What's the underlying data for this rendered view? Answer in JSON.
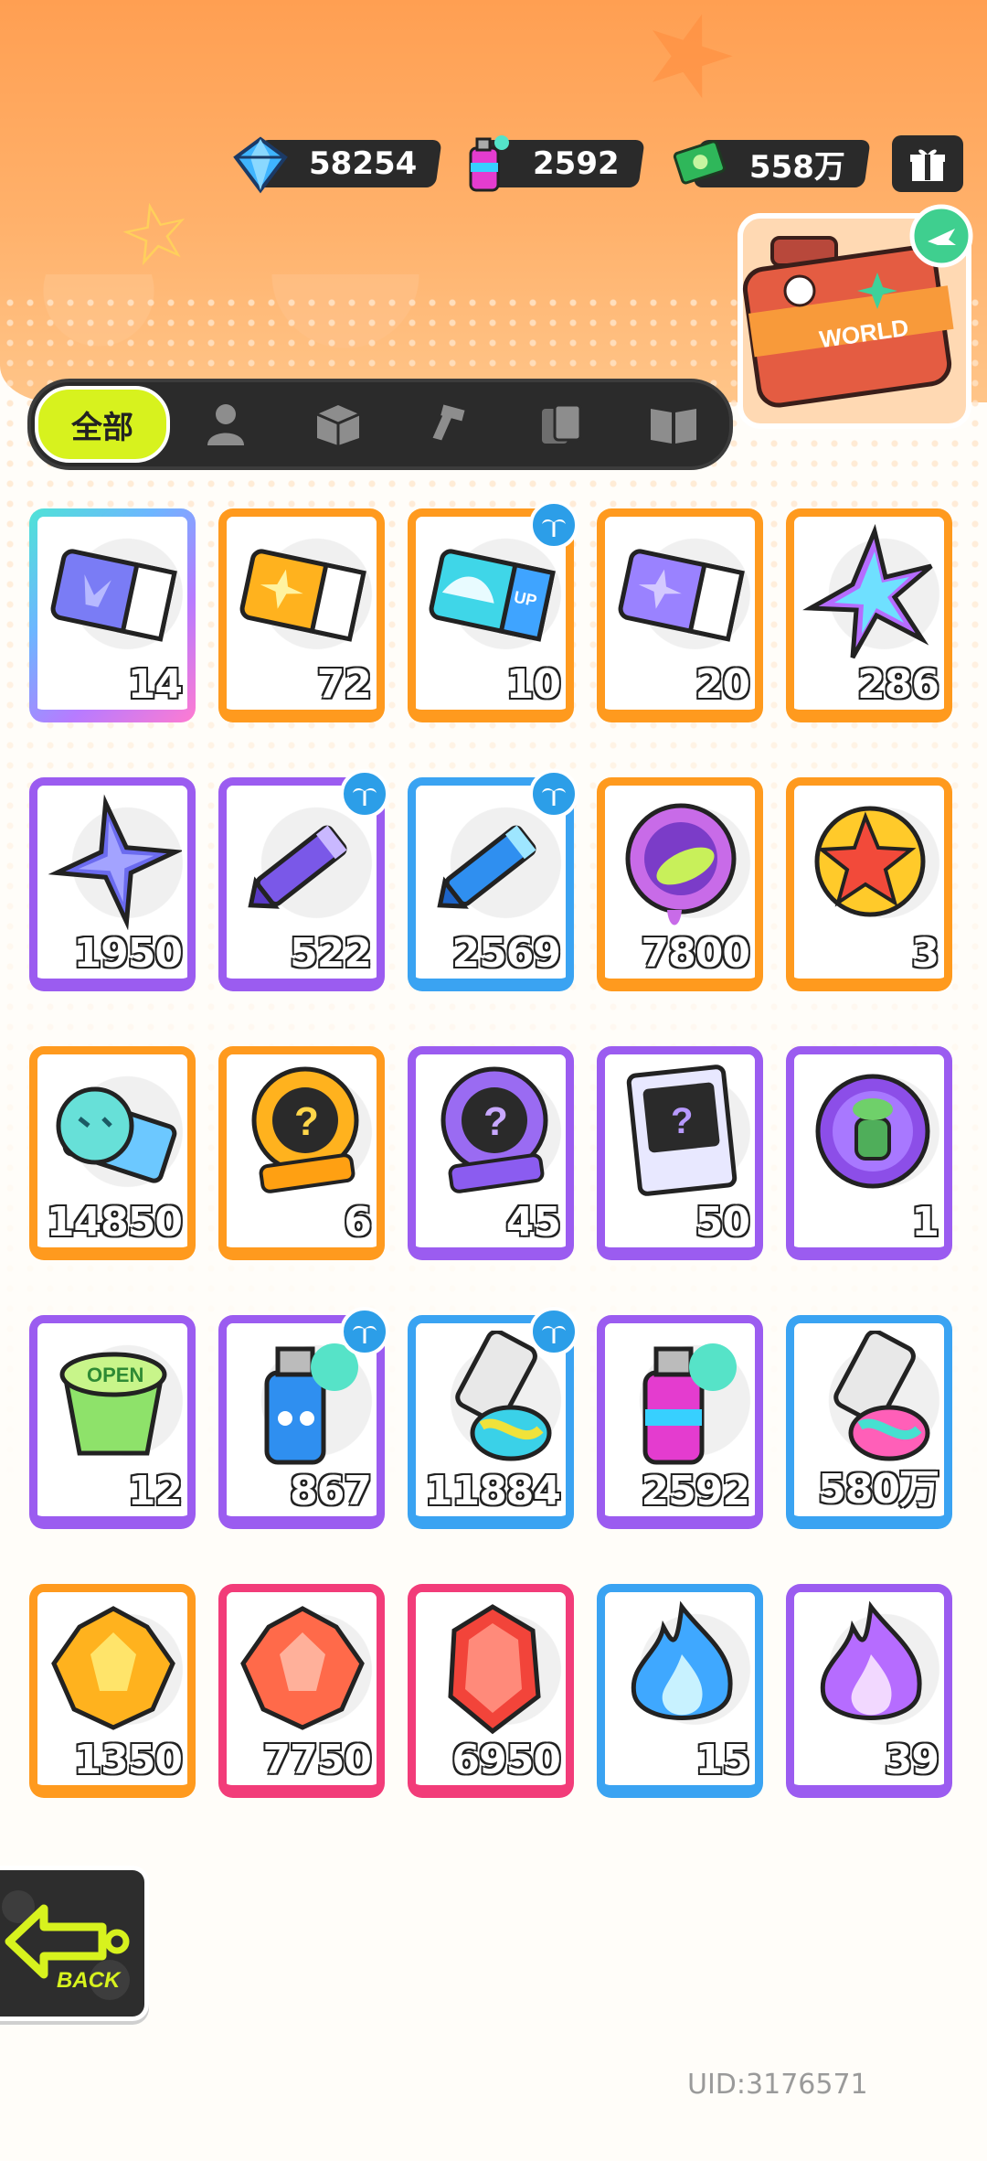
{
  "currency": [
    {
      "icon": "diamond-icon",
      "value": "58254"
    },
    {
      "icon": "spray-can-icon",
      "value": "2592"
    },
    {
      "icon": "cash-icon",
      "value": "558万"
    }
  ],
  "world_badge": {
    "label": "WORLD"
  },
  "tabs": {
    "all_label": "全部",
    "icons": [
      "person-icon",
      "box-icon",
      "gun-icon",
      "cards-icon",
      "book-icon"
    ]
  },
  "items": [
    {
      "art": "ticket-purple",
      "count": "14",
      "frame": "rainbow",
      "badge": false
    },
    {
      "art": "ticket-gold",
      "count": "72",
      "frame": "orange",
      "badge": false
    },
    {
      "art": "ticket-wave",
      "count": "10",
      "frame": "orange",
      "badge": true
    },
    {
      "art": "ticket-violet",
      "count": "20",
      "frame": "orange",
      "badge": false
    },
    {
      "art": "star-rainbow",
      "count": "286",
      "frame": "orange",
      "badge": false
    },
    {
      "art": "star-blue",
      "count": "1950",
      "frame": "purple",
      "badge": false
    },
    {
      "art": "crayon-purple",
      "count": "522",
      "frame": "purple",
      "badge": true
    },
    {
      "art": "crayon-blue",
      "count": "2569",
      "frame": "blue",
      "badge": true
    },
    {
      "art": "cool-badge",
      "count": "7800",
      "frame": "orange",
      "badge": false
    },
    {
      "art": "star-badge",
      "count": "3",
      "frame": "orange",
      "badge": false
    },
    {
      "art": "season-ticket",
      "count": "14850",
      "frame": "orange",
      "badge": false
    },
    {
      "art": "deity-gold",
      "count": "6",
      "frame": "orange",
      "badge": false
    },
    {
      "art": "deity-purple",
      "count": "45",
      "frame": "purple",
      "badge": false
    },
    {
      "art": "travel-card",
      "count": "50",
      "frame": "purple",
      "badge": false
    },
    {
      "art": "pet-ball",
      "count": "1",
      "frame": "purple",
      "badge": false
    },
    {
      "art": "open-cup",
      "count": "12",
      "frame": "purple",
      "badge": false
    },
    {
      "art": "spray-blue",
      "count": "867",
      "frame": "purple",
      "badge": true
    },
    {
      "art": "tube-blue",
      "count": "11884",
      "frame": "blue",
      "badge": true
    },
    {
      "art": "spray-pink",
      "count": "2592",
      "frame": "purple",
      "badge": false
    },
    {
      "art": "tube-pink",
      "count": "580万",
      "frame": "blue",
      "badge": false
    },
    {
      "art": "gem-gold",
      "count": "1350",
      "frame": "orange",
      "badge": false
    },
    {
      "art": "gem-red",
      "count": "7750",
      "frame": "pink",
      "badge": false
    },
    {
      "art": "crystal-red",
      "count": "6950",
      "frame": "pink",
      "badge": false
    },
    {
      "art": "flame-blue",
      "count": "15",
      "frame": "blue",
      "badge": false
    },
    {
      "art": "flame-purple",
      "count": "39",
      "frame": "purple",
      "badge": false
    }
  ],
  "back": {
    "label": "BACK"
  },
  "uid": "UID:3176571"
}
